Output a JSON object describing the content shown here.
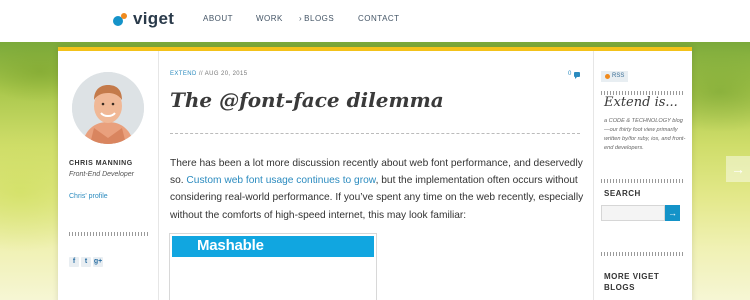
{
  "header": {
    "logo_text": "viget",
    "nav": [
      {
        "label": "ABOUT",
        "active": false
      },
      {
        "label": "WORK",
        "active": false
      },
      {
        "label": "BLOGS",
        "active": true
      },
      {
        "label": "CONTACT",
        "active": false
      }
    ]
  },
  "author": {
    "name": "CHRIS MANNING",
    "role": "Front-End Developer",
    "profile_link": "Chris' profile",
    "share_icons": [
      "facebook-icon",
      "twitter-icon",
      "google-plus-icon"
    ],
    "share_glyphs": [
      "f",
      "t",
      "g+"
    ]
  },
  "article": {
    "category": "EXTEND",
    "separator": " // ",
    "date": "AUG 20, 2015",
    "comment_count": "0",
    "title": "The @font-face dilemma",
    "body_1": "There has been a lot more discussion recently about web font performance, and deservedly so. ",
    "body_link": "Custom web font usage continues to grow",
    "body_2": ", but the implementation often occurs without considering real-world performance. If you’ve spent any time on the web recently, especially without the comforts of high-speed internet, this may look familiar:",
    "embed_logo": "Mashable"
  },
  "sidebar": {
    "rss_label": "RSS",
    "blog_title": "Extend is...",
    "blog_desc": "a CODE & TECHNOLOGY blog—our thirty foot view primarily written by/for ruby, ios, and front-end developers.",
    "search_label": "SEARCH",
    "search_value": "",
    "search_button": "→",
    "more_label": "MORE VIGET BLOGS"
  },
  "pager": {
    "next_glyph": "→"
  },
  "colors": {
    "accent": "#f3c21a",
    "link": "#2b8bbf",
    "mashable_blue": "#11a6e0"
  }
}
